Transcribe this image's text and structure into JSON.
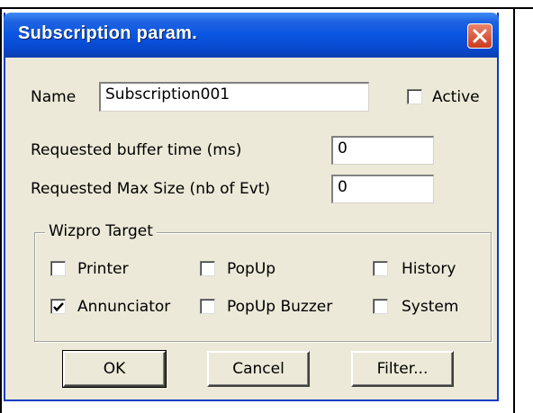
{
  "window": {
    "title": "Subscription param."
  },
  "form": {
    "name_label": "Name",
    "name_value": "Subscription001",
    "active_label": "Active",
    "active_checked": false,
    "buffer_time_label": "Requested buffer time (ms)",
    "buffer_time_value": "0",
    "max_size_label": "Requested Max Size (nb of Evt)",
    "max_size_value": "0"
  },
  "wizpro_target": {
    "legend": "Wizpro Target",
    "options": [
      {
        "label": "Printer",
        "checked": false
      },
      {
        "label": "PopUp",
        "checked": false
      },
      {
        "label": "History",
        "checked": false
      },
      {
        "label": "Annunciator",
        "checked": true
      },
      {
        "label": "PopUp Buzzer",
        "checked": false
      },
      {
        "label": "System",
        "checked": false
      }
    ]
  },
  "buttons": {
    "ok_label": "OK",
    "cancel_label": "Cancel",
    "filter_label": "Filter..."
  },
  "icons": {
    "close": "close-icon",
    "check": "checkmark-icon"
  },
  "colors": {
    "titlebar": "#0a55e3",
    "dialog_bg": "#ece9d8",
    "close_button": "#c93c1f"
  }
}
